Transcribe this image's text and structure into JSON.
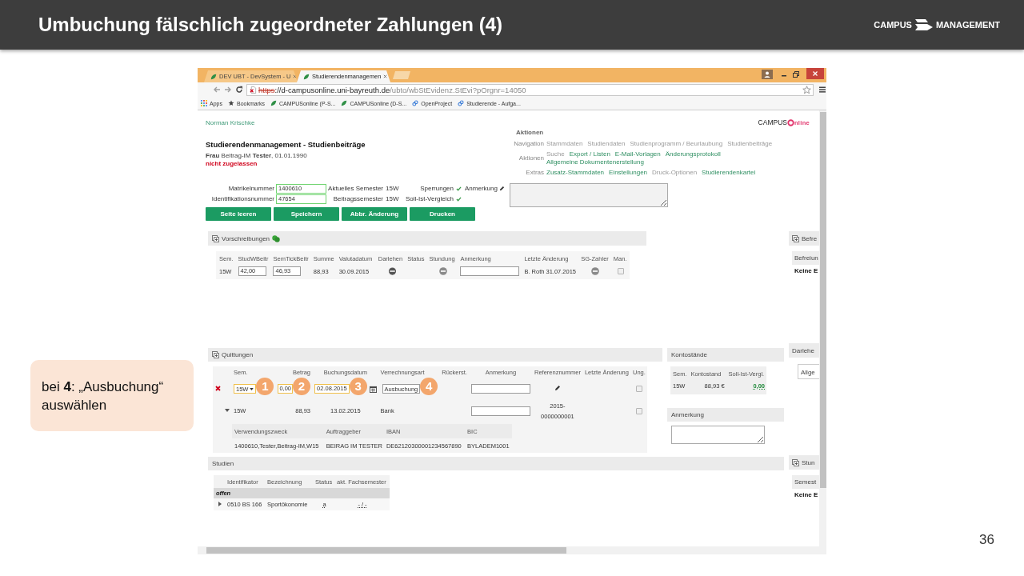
{
  "slide": {
    "title": "Umbuchung fälschlich zugeordneter Zahlungen (4)",
    "logo": {
      "left": "CAMPUS",
      "right": "MANAGEMENT"
    },
    "page_number": "36"
  },
  "callout": {
    "text": "bei **4**: „Ausbuchung“ auswählen"
  },
  "browser": {
    "tabs": [
      {
        "label": "DEV UBT - DevSystem - U",
        "selected": false
      },
      {
        "label": "Studierendenmanagemen",
        "selected": true
      }
    ],
    "address": {
      "insecure": true,
      "scheme": "https",
      "host": "://d-campusonline.uni-bayreuth.de",
      "path": "/ubto/wbStEvidenz.StEvi?pOrgnr=14050"
    },
    "bookmarks": [
      {
        "kind": "apps",
        "label": "Apps"
      },
      {
        "kind": "star",
        "label": "Bookmarks"
      },
      {
        "kind": "campus",
        "label": "CAMPUSonline (P-S..."
      },
      {
        "kind": "campus",
        "label": "CAMPUSonline (D-S..."
      },
      {
        "kind": "link",
        "label": "OpenProject"
      },
      {
        "kind": "link",
        "label": "Studierende - Aufga..."
      }
    ]
  },
  "page": {
    "user": "Norman Krischke",
    "logo": {
      "before": "CAMPUS",
      "after": "nline"
    },
    "heading": "Studierendenmanagement - Studienbeiträge",
    "person": "**Frau** Beitrag-IM **Tester**, 01.01.1990",
    "status": "nicht zugelassen",
    "actions": {
      "title": "Aktionen",
      "groups": [
        {
          "label": "Navigation",
          "items": [
            {
              "label": "Stammdaten",
              "disabled": true
            },
            {
              "label": "Studiendaten",
              "disabled": true
            },
            {
              "label": "Studienprogramm / Beurlaubung",
              "disabled": true
            },
            {
              "label": "Studienbeiträge",
              "disabled": true
            }
          ]
        },
        {
          "label": "Aktionen",
          "items": [
            {
              "label": "Suche",
              "disabled": true
            },
            {
              "label": "Export / Listen",
              "disabled": false
            },
            {
              "label": "E-Mail-Vorlagen",
              "disabled": false
            },
            {
              "label": "Änderungsprotokoll",
              "disabled": false
            },
            {
              "label": "Allgemeine Dokumentenerstellung",
              "disabled": false
            }
          ]
        },
        {
          "label": "Extras",
          "items": [
            {
              "label": "Zusatz-Stammdaten",
              "disabled": false
            },
            {
              "label": "Einstellungen",
              "disabled": false
            },
            {
              "label": "Druck-Optionen",
              "disabled": true
            },
            {
              "label": "Studierendenkartei",
              "disabled": false
            }
          ]
        }
      ]
    },
    "form": {
      "fields": [
        {
          "label": "Matrikelnummer",
          "value": "1400610"
        },
        {
          "label": "Identifikationsnummer",
          "value": "47654"
        }
      ],
      "semesters": [
        {
          "label": "Aktuelles Semester",
          "value": "15W"
        },
        {
          "label": "Beitragssemester",
          "value": "15W"
        }
      ],
      "flags": [
        {
          "label": "Sperrungen",
          "checked": true
        },
        {
          "label": "Soll-Ist-Vergleich",
          "checked": true
        }
      ],
      "remark_label": "Anmerkung"
    },
    "buttons": [
      "Seite leeren",
      "Speichern",
      "Abbr. Änderung",
      "Drucken"
    ],
    "prescriptions": {
      "title": "Vorschreibungen",
      "collapsible": true,
      "columns": [
        "Sem.",
        "StudWBeitr",
        "SemTickBeitr",
        "Summe",
        "Valutadatum",
        "Darlehen",
        "Status",
        "Stundung",
        "Anmerkung",
        "Letzte Änderung",
        "SG-Zahler",
        "Man."
      ],
      "rows": [
        {
          "cells": [
            {
              "kind": "text",
              "text": "15W"
            },
            {
              "kind": "input",
              "value": "42,00"
            },
            {
              "kind": "input",
              "value": "46,93"
            },
            {
              "kind": "text",
              "text": "88,93"
            },
            {
              "kind": "text",
              "text": "30.09.2015"
            },
            {
              "kind": "disc"
            },
            {
              "kind": "blank"
            },
            {
              "kind": "minus"
            },
            {
              "kind": "input"
            },
            {
              "kind": "text",
              "text": "B. Roth 31.07.2015"
            },
            {
              "kind": "minus"
            },
            {
              "kind": "checkbox",
              "checked": false
            }
          ]
        }
      ]
    },
    "receipts": {
      "title": "Quittungen",
      "collapsible": true,
      "columns": [
        "Sem.",
        "Betrag",
        "Buchungsdatum",
        "Verrechnungsart",
        "Rückerst.",
        "Anmerkung",
        "Referenznummer",
        "Letzte Änderung",
        "Ung."
      ],
      "rows": [
        {
          "kind": "edit",
          "sem": "15W",
          "amount": "0,00",
          "date": "02.08.2015",
          "type": "Ausbuchung",
          "steps": [
            "1",
            "2",
            "3",
            "4"
          ],
          "checked": false
        },
        {
          "kind": "entry",
          "expanded": true,
          "sem": "15W",
          "amount": "88,93",
          "date": "13.02.2015",
          "type": "Bank",
          "reference": "2015-0000000001",
          "checked": false,
          "details": {
            "columns": [
              "Verwendungszweck",
              "Auftraggeber",
              "IBAN",
              "BIC"
            ],
            "values": [
              "1400610,Tester,Beitrag-IM,W15",
              "BEIRAG IM TESTER",
              "DE62120300001234567890",
              "BYLADEM1001"
            ]
          }
        }
      ]
    },
    "balances": {
      "title": "Kontostände",
      "collapsible": false,
      "columns": [
        "Sem.",
        "Kontostand",
        "Soll-Ist-Vergl."
      ],
      "rows": [
        {
          "sem": "15W",
          "balance": "88,93 €",
          "difference": "0,00"
        }
      ]
    },
    "note": {
      "title": "Anmerkung",
      "collapsible": false
    },
    "studies": {
      "title": "Studien",
      "collapsible": false,
      "columns": [
        "Identifikator",
        "Bezeichnung",
        "Status",
        "akt. Fachsemester"
      ],
      "groups": [
        {
          "label": "offen",
          "rows": [
            {
              "expanded": false,
              "id": "0510 BS 166",
              "name": "Sportökonomie",
              "status": "a",
              "semester": "- / -"
            }
          ]
        }
      ]
    },
    "side_panels": [
      {
        "title": "Befre",
        "collapsible": true,
        "kind": "table",
        "column": "Befreiun",
        "value": "Keine E"
      },
      {
        "title": "Darlehe",
        "collapsible": false,
        "kind": "select",
        "value": "Allge"
      },
      {
        "title": "Stun",
        "collapsible": true,
        "kind": "table",
        "column": "Semest",
        "value": "Keine E"
      }
    ]
  }
}
